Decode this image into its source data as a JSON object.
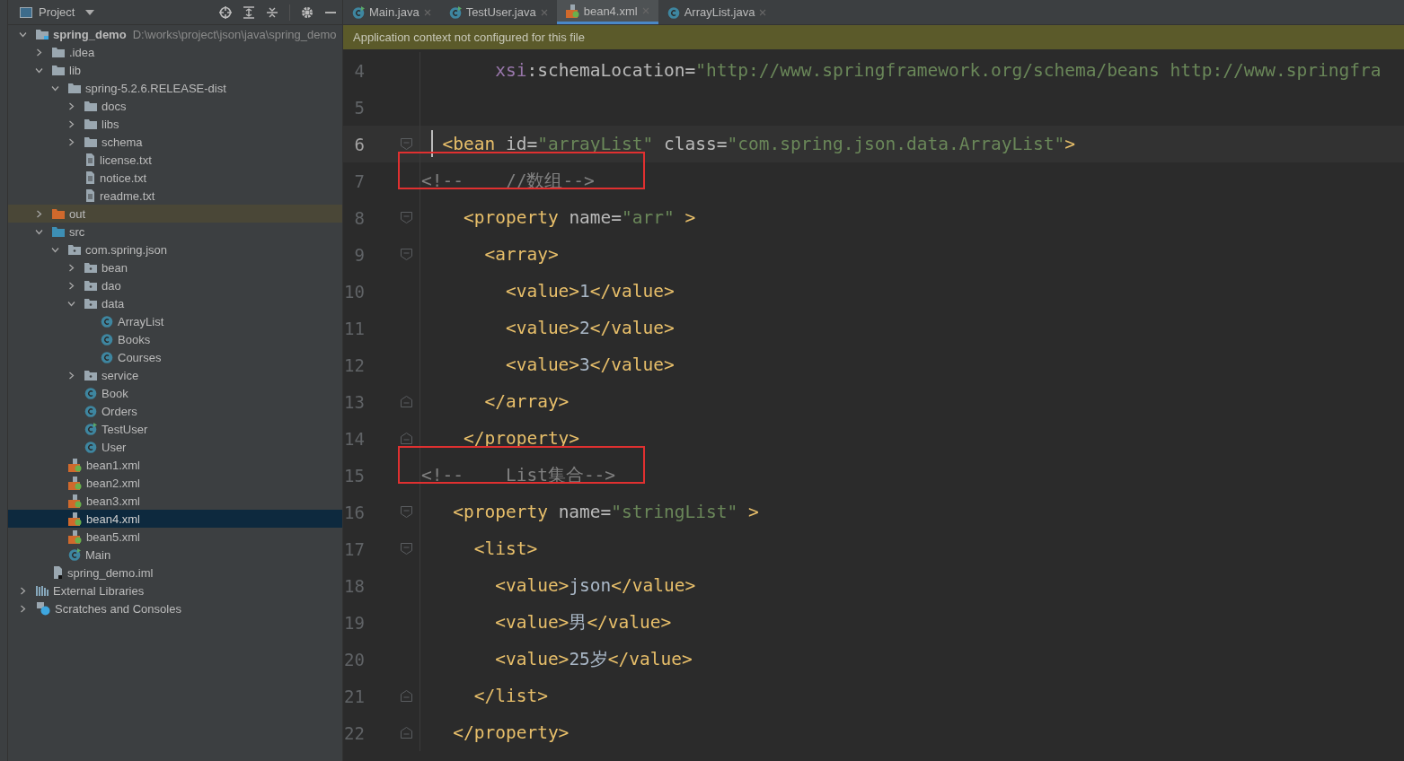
{
  "project_panel": {
    "title": "Project",
    "tree": [
      {
        "label": "spring_demo",
        "kind": "project",
        "path": "D:\\works\\project\\json\\java\\spring_demo",
        "expanded": true,
        "selected": false,
        "children": [
          {
            "label": ".idea",
            "kind": "folder",
            "expanded": false,
            "selected": false
          },
          {
            "label": "lib",
            "kind": "folder",
            "expanded": true,
            "selected": false,
            "children": [
              {
                "label": "spring-5.2.6.RELEASE-dist",
                "kind": "folder",
                "expanded": true,
                "selected": false,
                "children": [
                  {
                    "label": "docs",
                    "kind": "folder",
                    "expanded": false,
                    "selected": false
                  },
                  {
                    "label": "libs",
                    "kind": "folder",
                    "expanded": false,
                    "selected": false
                  },
                  {
                    "label": "schema",
                    "kind": "folder",
                    "expanded": false,
                    "selected": false
                  },
                  {
                    "label": "license.txt",
                    "kind": "text",
                    "selected": false
                  },
                  {
                    "label": "notice.txt",
                    "kind": "text",
                    "selected": false
                  },
                  {
                    "label": "readme.txt",
                    "kind": "text",
                    "selected": false
                  }
                ]
              }
            ]
          },
          {
            "label": "out",
            "kind": "excluded",
            "expanded": false,
            "selected": false
          },
          {
            "label": "src",
            "kind": "source",
            "expanded": true,
            "selected": false,
            "children": [
              {
                "label": "com.spring.json",
                "kind": "package",
                "expanded": true,
                "selected": false,
                "children": [
                  {
                    "label": "bean",
                    "kind": "package",
                    "expanded": false,
                    "selected": false
                  },
                  {
                    "label": "dao",
                    "kind": "package",
                    "expanded": false,
                    "selected": false
                  },
                  {
                    "label": "data",
                    "kind": "package",
                    "expanded": true,
                    "selected": false,
                    "children": [
                      {
                        "label": "ArrayList",
                        "kind": "class",
                        "selected": false
                      },
                      {
                        "label": "Books",
                        "kind": "class",
                        "selected": false
                      },
                      {
                        "label": "Courses",
                        "kind": "class",
                        "selected": false
                      }
                    ]
                  },
                  {
                    "label": "service",
                    "kind": "package",
                    "expanded": false,
                    "selected": false
                  },
                  {
                    "label": "Book",
                    "kind": "class",
                    "selected": false
                  },
                  {
                    "label": "Orders",
                    "kind": "class",
                    "selected": false
                  },
                  {
                    "label": "TestUser",
                    "kind": "runnable",
                    "selected": false
                  },
                  {
                    "label": "User",
                    "kind": "class",
                    "selected": false
                  }
                ]
              },
              {
                "label": "bean1.xml",
                "kind": "xml",
                "selected": false
              },
              {
                "label": "bean2.xml",
                "kind": "xml",
                "selected": false
              },
              {
                "label": "bean3.xml",
                "kind": "xml",
                "selected": false
              },
              {
                "label": "bean4.xml",
                "kind": "xml",
                "selected": true
              },
              {
                "label": "bean5.xml",
                "kind": "xml",
                "selected": false
              },
              {
                "label": "Main",
                "kind": "runnable",
                "selected": false
              }
            ]
          },
          {
            "label": "spring_demo.iml",
            "kind": "iml",
            "selected": false
          }
        ]
      },
      {
        "label": "External Libraries",
        "kind": "libraries",
        "expanded": false,
        "selected": false
      },
      {
        "label": "Scratches and Consoles",
        "kind": "scratches",
        "expanded": false,
        "selected": false
      }
    ]
  },
  "tabs": [
    {
      "label": "Main.java",
      "kind": "runnable",
      "selected": false
    },
    {
      "label": "TestUser.java",
      "kind": "runnable",
      "selected": false
    },
    {
      "label": "bean4.xml",
      "kind": "xml",
      "selected": true
    },
    {
      "label": "ArrayList.java",
      "kind": "class",
      "selected": false
    }
  ],
  "banner": "Application context not configured for this file",
  "lines": [
    {
      "number": "4",
      "current": false,
      "boxed": false,
      "cursor": false,
      "fold_open": false,
      "fold_close": false,
      "tokens": [
        {
          "kind": "ns",
          "text": "       xsi"
        },
        {
          "kind": "attr",
          "text": ":schemaLocation"
        },
        {
          "kind": "punct",
          "text": "="
        },
        {
          "kind": "str",
          "text": "\"http://www.springframework.org/schema/beans http://www.springfra"
        }
      ]
    },
    {
      "number": "5",
      "current": false,
      "boxed": false,
      "cursor": false,
      "fold_open": false,
      "fold_close": false
    },
    {
      "number": "6",
      "current": true,
      "boxed": false,
      "cursor": true,
      "fold_open": true,
      "fold_close": false,
      "tokens": [
        {
          "kind": "tag",
          "text": "  <bean "
        },
        {
          "kind": "attr",
          "text": "id"
        },
        {
          "kind": "punct",
          "text": "="
        },
        {
          "kind": "str",
          "text": "\"arrayList\""
        },
        {
          "kind": "attr",
          "text": " class"
        },
        {
          "kind": "punct",
          "text": "="
        },
        {
          "kind": "str",
          "text": "\"com.spring.json.data.ArrayList\""
        },
        {
          "kind": "tag",
          "text": ">"
        }
      ]
    },
    {
      "number": "7",
      "current": false,
      "boxed": true,
      "cursor": false,
      "fold_open": false,
      "fold_close": false,
      "tokens": [
        {
          "kind": "comment",
          "text": "<!--    //数组-->"
        }
      ]
    },
    {
      "number": "8",
      "current": false,
      "boxed": false,
      "cursor": false,
      "fold_open": true,
      "fold_close": false,
      "tokens": [
        {
          "kind": "tag",
          "text": "    <property "
        },
        {
          "kind": "attr",
          "text": "name"
        },
        {
          "kind": "punct",
          "text": "="
        },
        {
          "kind": "str",
          "text": "\"arr\""
        },
        {
          "kind": "tag",
          "text": " >"
        }
      ]
    },
    {
      "number": "9",
      "current": false,
      "boxed": false,
      "cursor": false,
      "fold_open": true,
      "fold_close": false,
      "tokens": [
        {
          "kind": "tag",
          "text": "      <array>"
        }
      ]
    },
    {
      "number": "10",
      "current": false,
      "boxed": false,
      "cursor": false,
      "fold_open": false,
      "fold_close": false,
      "tokens": [
        {
          "kind": "tag",
          "text": "        <value>"
        },
        {
          "kind": "text",
          "text": "1"
        },
        {
          "kind": "tag",
          "text": "</value>"
        }
      ]
    },
    {
      "number": "11",
      "current": false,
      "boxed": false,
      "cursor": false,
      "fold_open": false,
      "fold_close": false,
      "tokens": [
        {
          "kind": "tag",
          "text": "        <value>"
        },
        {
          "kind": "text",
          "text": "2"
        },
        {
          "kind": "tag",
          "text": "</value>"
        }
      ]
    },
    {
      "number": "12",
      "current": false,
      "boxed": false,
      "cursor": false,
      "fold_open": false,
      "fold_close": false,
      "tokens": [
        {
          "kind": "tag",
          "text": "        <value>"
        },
        {
          "kind": "text",
          "text": "3"
        },
        {
          "kind": "tag",
          "text": "</value>"
        }
      ]
    },
    {
      "number": "13",
      "current": false,
      "boxed": false,
      "cursor": false,
      "fold_open": false,
      "fold_close": true,
      "tokens": [
        {
          "kind": "tag",
          "text": "      </array>"
        }
      ]
    },
    {
      "number": "14",
      "current": false,
      "boxed": false,
      "cursor": false,
      "fold_open": false,
      "fold_close": true,
      "tokens": [
        {
          "kind": "tag",
          "text": "    </property>"
        }
      ]
    },
    {
      "number": "15",
      "current": false,
      "boxed": true,
      "cursor": false,
      "fold_open": false,
      "fold_close": false,
      "tokens": [
        {
          "kind": "comment",
          "text": "<!--    List集合-->"
        }
      ]
    },
    {
      "number": "16",
      "current": false,
      "boxed": false,
      "cursor": false,
      "fold_open": true,
      "fold_close": false,
      "tokens": [
        {
          "kind": "tag",
          "text": "   <property "
        },
        {
          "kind": "attr",
          "text": "name"
        },
        {
          "kind": "punct",
          "text": "="
        },
        {
          "kind": "str",
          "text": "\"stringList\""
        },
        {
          "kind": "tag",
          "text": " >"
        }
      ]
    },
    {
      "number": "17",
      "current": false,
      "boxed": false,
      "cursor": false,
      "fold_open": true,
      "fold_close": false,
      "tokens": [
        {
          "kind": "tag",
          "text": "     <list>"
        }
      ]
    },
    {
      "number": "18",
      "current": false,
      "boxed": false,
      "cursor": false,
      "fold_open": false,
      "fold_close": false,
      "tokens": [
        {
          "kind": "tag",
          "text": "       <value>"
        },
        {
          "kind": "text",
          "text": "json"
        },
        {
          "kind": "tag",
          "text": "</value>"
        }
      ]
    },
    {
      "number": "19",
      "current": false,
      "boxed": false,
      "cursor": false,
      "fold_open": false,
      "fold_close": false,
      "tokens": [
        {
          "kind": "tag",
          "text": "       <value>"
        },
        {
          "kind": "text",
          "text": "男"
        },
        {
          "kind": "tag",
          "text": "</value>"
        }
      ]
    },
    {
      "number": "20",
      "current": false,
      "boxed": false,
      "cursor": false,
      "fold_open": false,
      "fold_close": false,
      "tokens": [
        {
          "kind": "tag",
          "text": "       <value>"
        },
        {
          "kind": "text",
          "text": "25岁"
        },
        {
          "kind": "tag",
          "text": "</value>"
        }
      ]
    },
    {
      "number": "21",
      "current": false,
      "boxed": false,
      "cursor": false,
      "fold_open": false,
      "fold_close": true,
      "tokens": [
        {
          "kind": "tag",
          "text": "     </list>"
        }
      ]
    },
    {
      "number": "22",
      "current": false,
      "boxed": false,
      "cursor": false,
      "fold_open": false,
      "fold_close": true,
      "tokens": [
        {
          "kind": "tag",
          "text": "   </property>"
        }
      ]
    }
  ]
}
